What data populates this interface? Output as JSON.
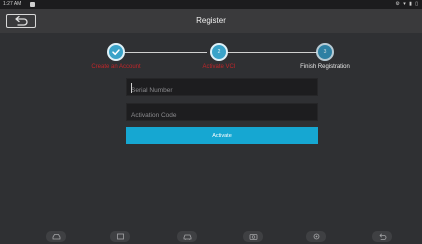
{
  "status_bar": {
    "time": "1:27 AM",
    "system_icons": "⚙ ▾ ▮ ▯"
  },
  "header": {
    "title": "Register",
    "back_icon": "back-arrow-icon"
  },
  "stepper": {
    "steps": [
      {
        "label": "Create an Account",
        "state": "done"
      },
      {
        "label": "Activate VCI",
        "state": "active",
        "number": "2"
      },
      {
        "label": "Finish Registration",
        "state": "future",
        "number": "3"
      }
    ]
  },
  "form": {
    "serial_placeholder": "Serial Number",
    "activation_placeholder": "Activation Code",
    "activate_label": "Activate"
  },
  "navbar": {
    "icons": [
      "vehicle-icon",
      "home-icon",
      "car-icon",
      "camera-icon",
      "settings-icon",
      "back-icon"
    ]
  },
  "colors": {
    "accent": "#16a7d2",
    "step_red": "#c0262a",
    "background": "#2f3033"
  }
}
